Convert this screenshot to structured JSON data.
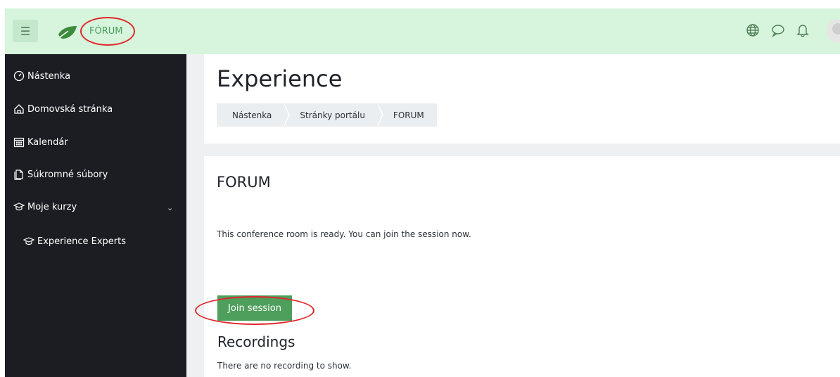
{
  "navbar": {
    "brand": "FÓRUM",
    "icons": [
      "menu-icon",
      "leaf-logo-icon",
      "globe-icon",
      "chat-icon",
      "bell-icon",
      "avatar"
    ]
  },
  "sidebar": {
    "items": [
      {
        "label": "Nástenka",
        "icon": "dashboard-icon"
      },
      {
        "label": "Domovská stránka",
        "icon": "home-icon"
      },
      {
        "label": "Kalendár",
        "icon": "calendar-icon"
      },
      {
        "label": "Súkromné súbory",
        "icon": "files-icon"
      },
      {
        "label": "Moje kurzy",
        "icon": "graduation-cap-icon"
      },
      {
        "label": "Experience Experts",
        "icon": "graduation-cap-icon"
      }
    ]
  },
  "header": {
    "title": "Experience",
    "breadcrumb": [
      "Nástenka",
      "Stránky portálu",
      "FORUM"
    ]
  },
  "content": {
    "title": "FORUM",
    "status_text": "This conference room is ready. You can join the session now.",
    "join_button": "Join session",
    "recordings_title": "Recordings",
    "recordings_text": "There are no recording to show."
  },
  "colors": {
    "navbar_bg": "#d6f5dc",
    "sidebar_bg": "#1b1d22",
    "primary_button": "#4e9e5c",
    "annotation_red": "#e0262a"
  }
}
